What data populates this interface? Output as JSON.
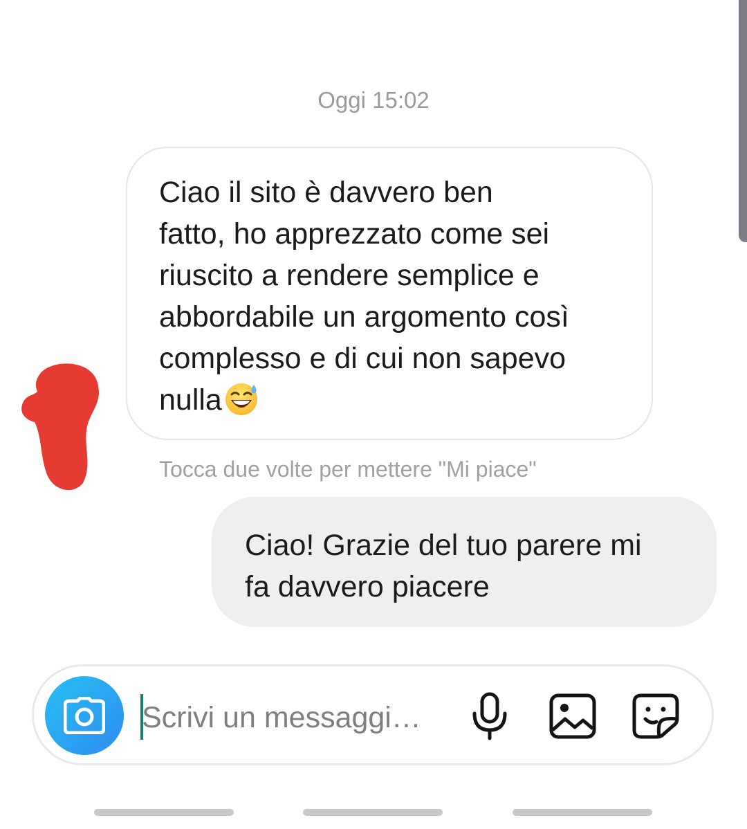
{
  "conversation": {
    "timestamp": "Oggi 15:02",
    "incoming_message": {
      "text": "Ciao il sito è davvero ben\nfatto, ho apprezzato come sei\nriuscito a rendere semplice e\nabbordabile un argomento così\ncomplesso e di cui non sapevo\nnulla",
      "emoji": "grinning-face-with-sweat-icon",
      "hint": "Tocca due volte per mettere \"Mi piace\""
    },
    "outgoing_message": {
      "text": "Ciao! Grazie del tuo parere mi\nfa davvero piacere"
    }
  },
  "composer": {
    "placeholder": "Scrivi un messaggi…",
    "icons": [
      "camera-icon",
      "microphone-icon",
      "gallery-icon",
      "sticker-icon"
    ],
    "camera_gradient": [
      "#27c0f2",
      "#2f8bf0"
    ]
  },
  "colors": {
    "avatar_redaction": "#e53b32",
    "outgoing_bubble": "#efefef",
    "caret": "#17806d"
  }
}
